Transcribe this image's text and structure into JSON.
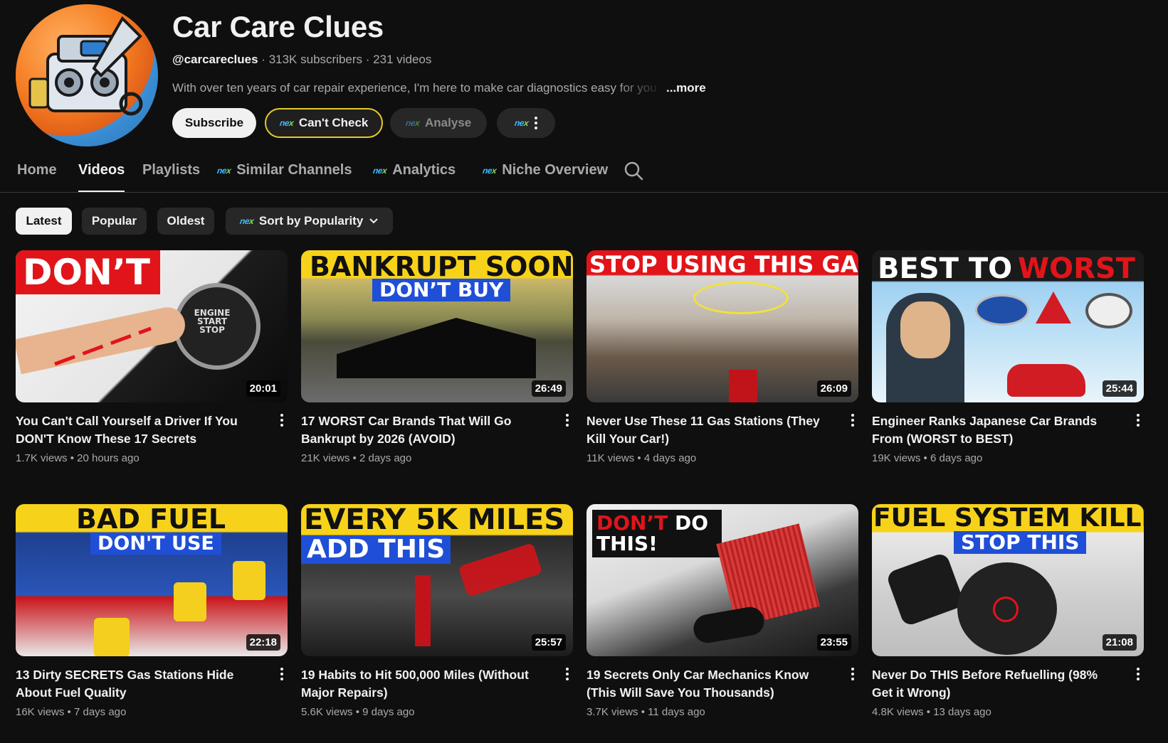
{
  "channel": {
    "name": "Car Care Clues",
    "handle": "@carcareclues",
    "subscribers": "313K subscribers",
    "videos": "231 videos",
    "description": "With over ten years of car repair experience, I'm here to make car diagnostics easy for you",
    "more": "...more"
  },
  "buttons": {
    "subscribe": "Subscribe",
    "cant_check": "Can't Check",
    "analyse": "Analyse"
  },
  "tabs": {
    "home": "Home",
    "videos": "Videos",
    "playlists": "Playlists",
    "similar": "Similar Channels",
    "analytics": "Analytics",
    "niche": "Niche Overview"
  },
  "chips": {
    "latest": "Latest",
    "popular": "Popular",
    "oldest": "Oldest",
    "sort": "Sort by Popularity"
  },
  "videos": [
    {
      "title": "You Can't Call Yourself a Driver If You DON'T Know These 17 Secrets",
      "views": "1.7K views",
      "age": "20 hours ago",
      "duration": "20:01",
      "thumb_text": "DON’T",
      "thumb_sub": "ENGINE START STOP"
    },
    {
      "title": "17 WORST Car Brands That Will Go Bankrupt by 2026 (AVOID)",
      "views": "21K views",
      "age": "2 days ago",
      "duration": "26:49",
      "thumb_text": "BANKRUPT SOON",
      "thumb_sub": "DON’T BUY"
    },
    {
      "title": "Never Use These 11 Gas Stations (They Kill Your Car!)",
      "views": "11K views",
      "age": "4 days ago",
      "duration": "26:09",
      "thumb_text": "STOP USING THIS GAS",
      "thumb_sub": ""
    },
    {
      "title": "Engineer Ranks Japanese Car Brands From (WORST to BEST)",
      "views": "19K views",
      "age": "6 days ago",
      "duration": "25:44",
      "thumb_text": "BEST TO",
      "thumb_sub": "WORST"
    },
    {
      "title": "13 Dirty SECRETS Gas Stations Hide About Fuel Quality",
      "views": "16K views",
      "age": "7 days ago",
      "duration": "22:18",
      "thumb_text": "BAD FUEL",
      "thumb_sub": "DON'T USE"
    },
    {
      "title": "19 Habits to Hit 500,000 Miles (Without Major Repairs)",
      "views": "5.6K views",
      "age": "9 days ago",
      "duration": "25:57",
      "thumb_text": "EVERY 5K MILES",
      "thumb_sub": "ADD THIS"
    },
    {
      "title": "19 Secrets Only Car Mechanics Know (This Will Save You Thousands)",
      "views": "3.7K views",
      "age": "11 days ago",
      "duration": "23:55",
      "thumb_text": "DON’T",
      "thumb_sub": "DO THIS!"
    },
    {
      "title": "Never Do THIS Before Refuelling (98% Get it Wrong)",
      "views": "4.8K views",
      "age": "13 days ago",
      "duration": "21:08",
      "thumb_text": "FUEL SYSTEM KILLER",
      "thumb_sub": "STOP THIS"
    }
  ]
}
